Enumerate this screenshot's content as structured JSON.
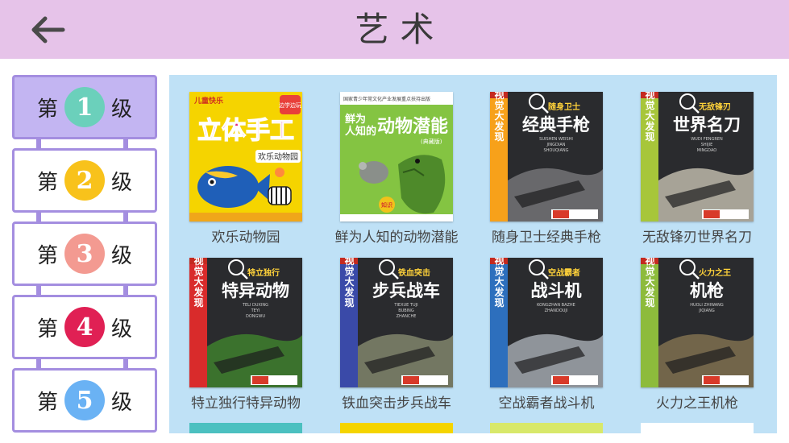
{
  "header": {
    "title": "艺术",
    "back_icon": "arrow-left-icon",
    "background": "#e6c3e9"
  },
  "sidebar": {
    "border_color": "#a48ee0",
    "active_background": "#c3b5f2",
    "levels": [
      {
        "prefix": "第",
        "number": "1",
        "suffix": "级",
        "badge_color": "#6bd0bb",
        "active": true
      },
      {
        "prefix": "第",
        "number": "2",
        "suffix": "级",
        "badge_color": "#f8c21b",
        "active": false
      },
      {
        "prefix": "第",
        "number": "3",
        "suffix": "级",
        "badge_color": "#f39a91",
        "active": false
      },
      {
        "prefix": "第",
        "number": "4",
        "suffix": "级",
        "badge_color": "#e02054",
        "active": false
      },
      {
        "prefix": "第",
        "number": "5",
        "suffix": "级",
        "badge_color": "#6ab2f4",
        "active": false
      }
    ]
  },
  "books": [
    {
      "title": "欢乐动物园",
      "cover": {
        "style": "kids",
        "background": "#f5d400",
        "texts": {
          "publisher": "儿童快乐",
          "main_line1": "立体手工",
          "sub": "欢乐动物园",
          "badge": "边学边玩"
        }
      }
    },
    {
      "title": "鲜为人知的动物潜能",
      "cover": {
        "style": "nature",
        "background": "#84c442",
        "texts": {
          "top_note": "国家青少年常文化产业发展重点扶持出版",
          "main_line1": "鲜为",
          "main_line2": "人知的",
          "main_line3": "动物潜能",
          "vol": "(典藏版)",
          "badge": "知识"
        }
      }
    },
    {
      "title": "随身卫士经典手枪",
      "cover": {
        "style": "military",
        "side_color": "#f7a11a",
        "texts": {
          "series": "视觉大发现",
          "tag": "随身卫士",
          "main": "经典手枪",
          "pinyin1": "SUISHEN WEISHI",
          "pinyin2": "JINGDIAN",
          "pinyin3": "SHOUQIANG"
        }
      }
    },
    {
      "title": "无敌锋刃世界名刀",
      "cover": {
        "style": "military",
        "side_color": "#a7c63a",
        "texts": {
          "series": "视觉大发现",
          "tag": "无敌锋刃",
          "main": "世界名刀",
          "pinyin1": "WUDI FENGREN",
          "pinyin2": "SHIJIE",
          "pinyin3": "MINGDAO"
        }
      }
    },
    {
      "title": "特立独行特异动物",
      "cover": {
        "style": "military",
        "side_color": "#d92b2b",
        "texts": {
          "series": "视觉大发现",
          "tag": "特立独行",
          "main": "特异动物",
          "pinyin1": "TELI DUXING",
          "pinyin2": "TEYI",
          "pinyin3": "DONGWU"
        }
      }
    },
    {
      "title": "铁血突击步兵战车",
      "cover": {
        "style": "military",
        "side_color": "#3a4aa8",
        "texts": {
          "series": "视觉大发现",
          "tag": "铁血突击",
          "main": "步兵战车",
          "pinyin1": "TIEXUE TUJI",
          "pinyin2": "BUBING",
          "pinyin3": "ZHANCHE"
        }
      }
    },
    {
      "title": "空战霸者战斗机",
      "cover": {
        "style": "military",
        "side_color": "#2d6fbd",
        "texts": {
          "series": "视觉大发现",
          "tag": "空战霸者",
          "main": "战斗机",
          "pinyin1": "KONGZHAN BAZHE",
          "pinyin2": "ZHANDOUJI",
          "pinyin3": ""
        }
      }
    },
    {
      "title": "火力之王机枪",
      "cover": {
        "style": "military",
        "side_color": "#8dbb3c",
        "texts": {
          "series": "视觉大发现",
          "tag": "火力之王",
          "main": "机枪",
          "pinyin1": "HUOLI ZHIWANG",
          "pinyin2": "JIQIANG",
          "pinyin3": ""
        }
      }
    }
  ],
  "next_row_peek_colors": [
    "#4bc0c0",
    "#f5d400",
    "#d8e86a",
    "#ffffff"
  ]
}
